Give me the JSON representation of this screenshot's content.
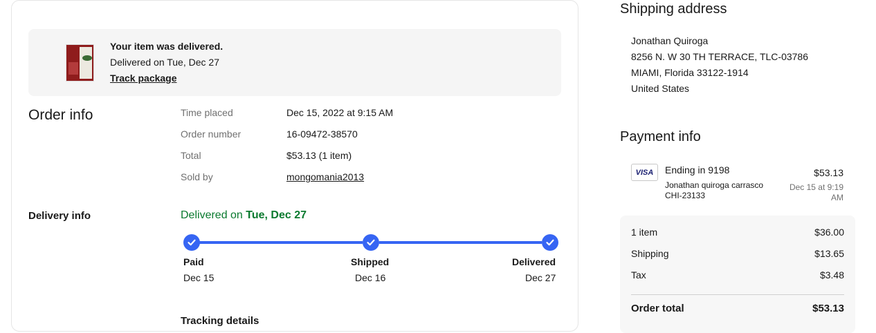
{
  "banner": {
    "title": "Your item was delivered.",
    "date": "Delivered on Tue, Dec 27",
    "track_link": "Track package"
  },
  "order_info": {
    "title": "Order info",
    "rows": [
      {
        "label": "Time placed",
        "value": "Dec 15, 2022 at 9:15 AM"
      },
      {
        "label": "Order number",
        "value": "16-09472-38570"
      },
      {
        "label": "Total",
        "value": "$53.13 (1 item)"
      },
      {
        "label": "Sold by",
        "value": "mongomania2013"
      }
    ]
  },
  "delivery_info": {
    "title": "Delivery info",
    "status_prefix": "Delivered on ",
    "status_date": "Tue, Dec 27",
    "status_color": "#0a7a2f",
    "progress_color": "#3665f3",
    "steps": [
      {
        "label": "Paid",
        "date": "Dec 15"
      },
      {
        "label": "Shipped",
        "date": "Dec 16"
      },
      {
        "label": "Delivered",
        "date": "Dec 27"
      }
    ],
    "tracking_details": "Tracking details"
  },
  "shipping_address": {
    "title": "Shipping address",
    "lines": [
      "Jonathan Quiroga",
      "8256 N. W 30 TH TERRACE, TLC-03786",
      "MIAMI, Florida 33122-1914",
      "United States"
    ]
  },
  "payment_info": {
    "title": "Payment info",
    "card_brand": "VISA",
    "card_ending": "Ending in 9198",
    "card_holder": "Jonathan quiroga carrasco",
    "card_code": "CHI-23133",
    "amount": "$53.13",
    "datetime_line1": "Dec 15 at 9:19",
    "datetime_line2": "AM"
  },
  "summary": {
    "rows": [
      {
        "label": "1 item",
        "value": "$36.00"
      },
      {
        "label": "Shipping",
        "value": "$13.65"
      },
      {
        "label": "Tax",
        "value": "$3.48"
      }
    ],
    "total_label": "Order total",
    "total_value": "$53.13"
  }
}
